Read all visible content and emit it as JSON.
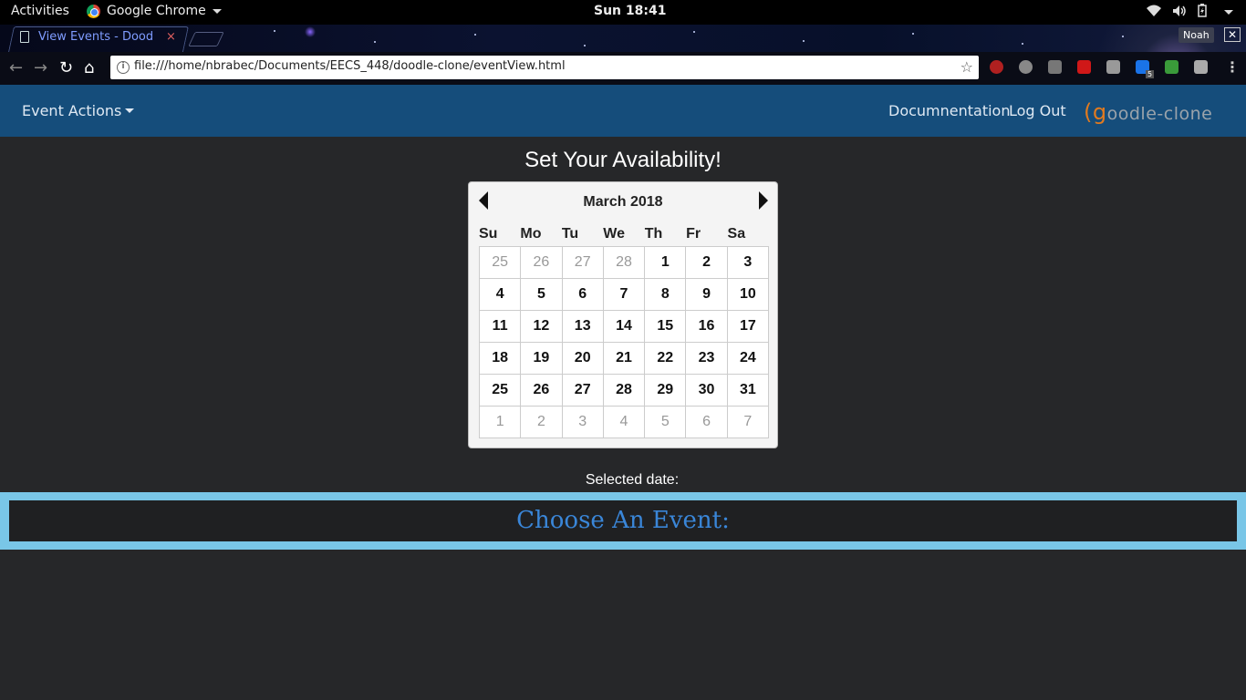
{
  "system_bar": {
    "activities": "Activities",
    "app_name": "Google Chrome",
    "clock": "Sun 18:41"
  },
  "browser": {
    "tab_title": "View Events - Dood",
    "tab_close": "×",
    "profile": "Noah",
    "window_close": "✕",
    "url": "file:///home/nbrabec/Documents/EECS_448/doodle-clone/eventView.html",
    "extension_badge": "5"
  },
  "navbar": {
    "event_actions": "Event Actions",
    "documentation": "Documnentation",
    "logout": "Log Out",
    "logo_text": "oodle-clone"
  },
  "main": {
    "title": "Set Your Availability!",
    "selected_date_label": "Selected date:",
    "event_heading": "Choose An Event:"
  },
  "calendar": {
    "month_label": "March 2018",
    "weekdays": [
      "Su",
      "Mo",
      "Tu",
      "We",
      "Th",
      "Fr",
      "Sa"
    ],
    "days": [
      {
        "d": "25",
        "other": true
      },
      {
        "d": "26",
        "other": true
      },
      {
        "d": "27",
        "other": true
      },
      {
        "d": "28",
        "other": true
      },
      {
        "d": "1"
      },
      {
        "d": "2"
      },
      {
        "d": "3"
      },
      {
        "d": "4"
      },
      {
        "d": "5"
      },
      {
        "d": "6"
      },
      {
        "d": "7"
      },
      {
        "d": "8"
      },
      {
        "d": "9"
      },
      {
        "d": "10"
      },
      {
        "d": "11"
      },
      {
        "d": "12"
      },
      {
        "d": "13"
      },
      {
        "d": "14"
      },
      {
        "d": "15"
      },
      {
        "d": "16"
      },
      {
        "d": "17"
      },
      {
        "d": "18"
      },
      {
        "d": "19"
      },
      {
        "d": "20"
      },
      {
        "d": "21"
      },
      {
        "d": "22"
      },
      {
        "d": "23"
      },
      {
        "d": "24"
      },
      {
        "d": "25"
      },
      {
        "d": "26"
      },
      {
        "d": "27"
      },
      {
        "d": "28"
      },
      {
        "d": "29"
      },
      {
        "d": "30"
      },
      {
        "d": "31"
      },
      {
        "d": "1",
        "other": true
      },
      {
        "d": "2",
        "other": true
      },
      {
        "d": "3",
        "other": true
      },
      {
        "d": "4",
        "other": true
      },
      {
        "d": "5",
        "other": true
      },
      {
        "d": "6",
        "other": true
      },
      {
        "d": "7",
        "other": true
      }
    ]
  },
  "colors": {
    "navbar_bg": "#154d7b",
    "page_bg": "#262729",
    "event_panel_border": "#79c6e7",
    "event_heading": "#3a86d8",
    "logo_accent": "#e07a1f"
  }
}
